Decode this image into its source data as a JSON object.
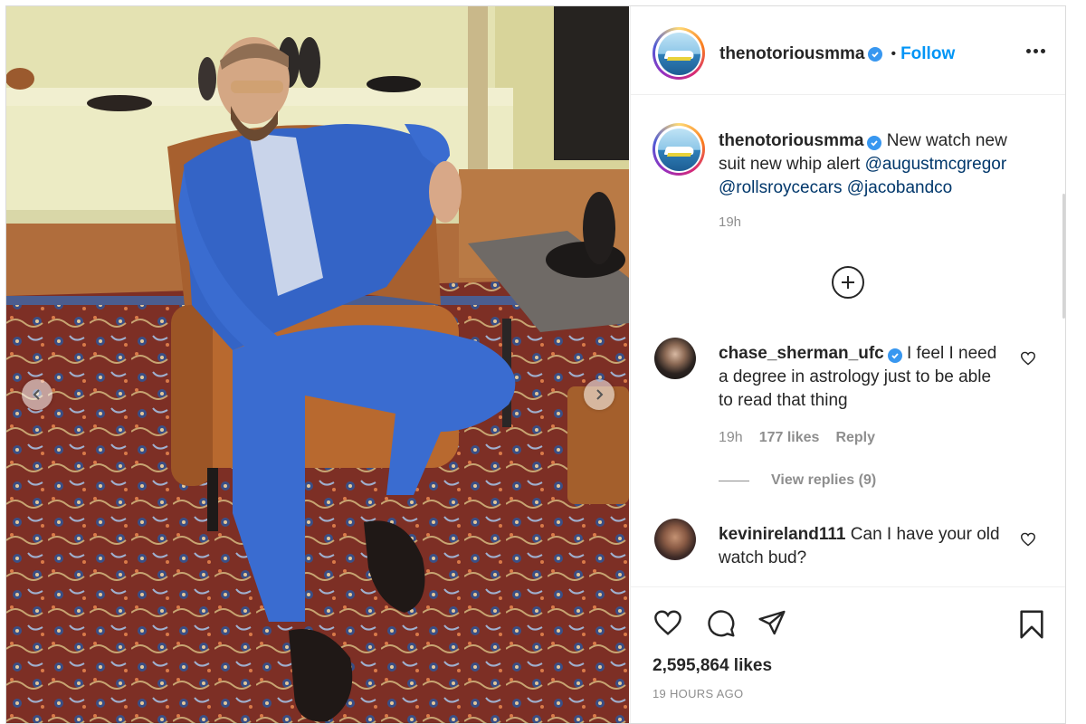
{
  "post": {
    "author": "thenotoriousmma",
    "follow_label": "Follow",
    "separator": "•"
  },
  "caption": {
    "username": "thenotoriousmma",
    "text": "New watch new suit new whip alert",
    "mentions": [
      "@augustmcgregor",
      "@rollsroycecars",
      "@jacobandco"
    ],
    "time": "19h"
  },
  "comments": [
    {
      "username": "chase_sherman_ufc",
      "verified": true,
      "text": "I feel I need a degree in astrology just to be able to read that thing",
      "time": "19h",
      "likes": "177 likes",
      "reply_label": "Reply",
      "view_replies": "View replies (9)"
    },
    {
      "username": "kevinireland111",
      "verified": false,
      "text": "Can I have your old watch bud?"
    }
  ],
  "footer": {
    "likes": "2,595,864 likes",
    "timestamp": "19 HOURS AGO"
  },
  "icons": {
    "like": "heart-icon",
    "comment": "comment-icon",
    "share": "share-icon",
    "save": "bookmark-icon",
    "more": "more-icon",
    "load_more": "plus-circle-icon",
    "verified": "verified-badge-icon",
    "carousel_prev": "chevron-left-icon",
    "carousel_next": "chevron-right-icon"
  },
  "colors": {
    "link": "#0095f6",
    "mention": "#00376b",
    "verified": "#3897f0",
    "muted": "#8e8e8e"
  }
}
